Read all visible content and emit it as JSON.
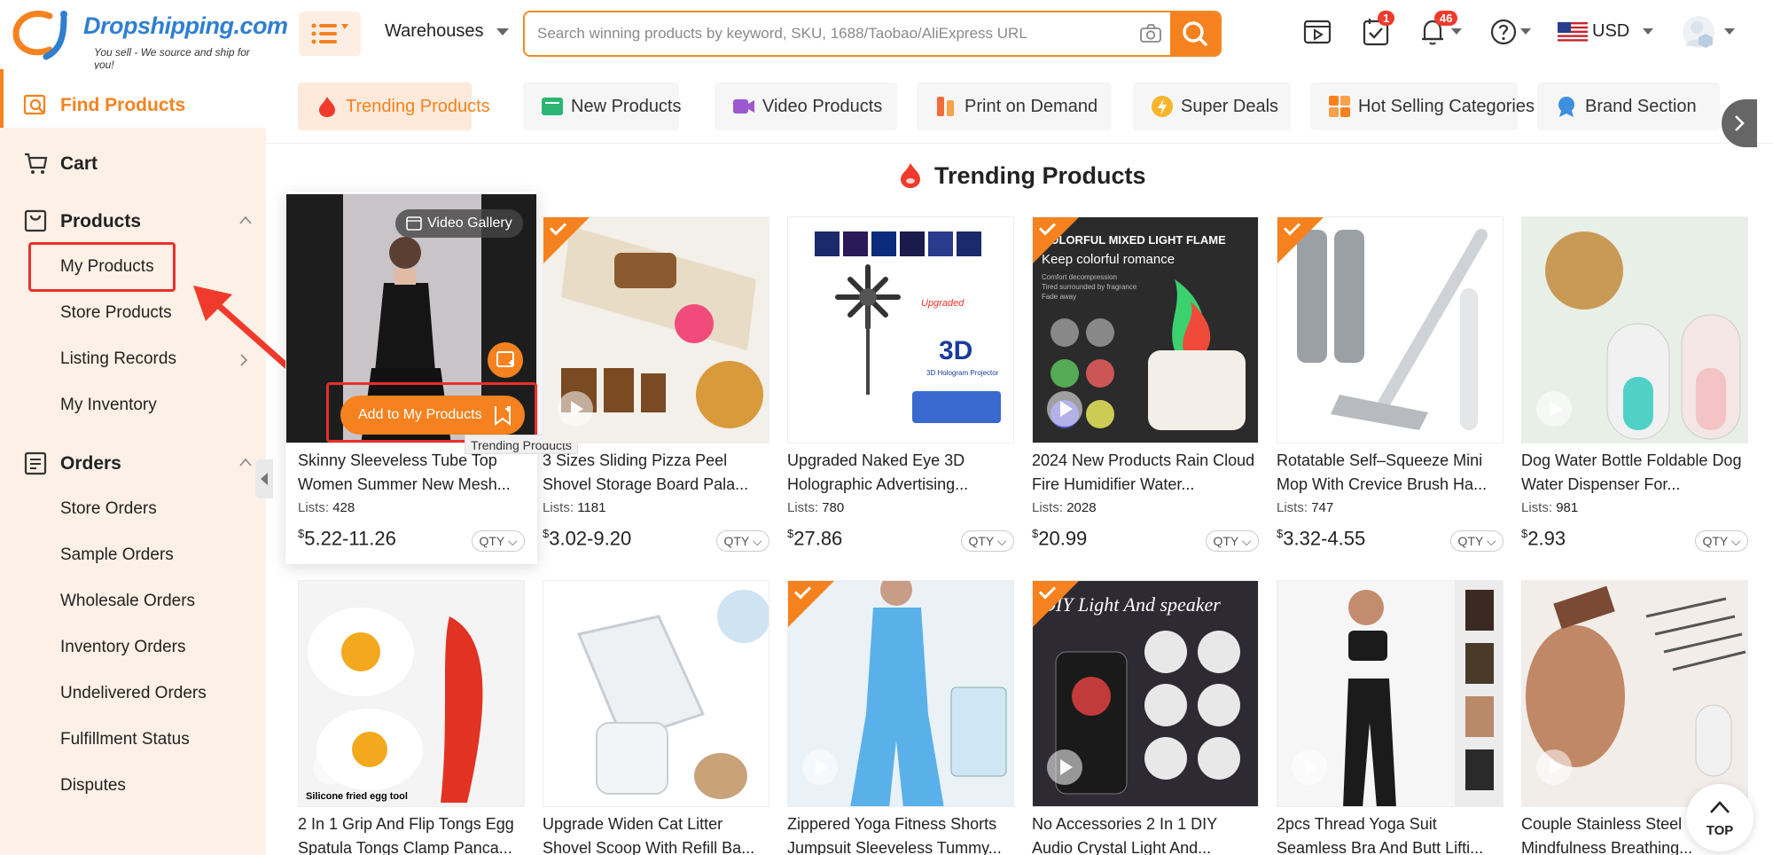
{
  "brand": {
    "name": "Dropshipping.com",
    "tagline": "You sell - We source and ship for you!"
  },
  "header": {
    "warehouses_label": "Warehouses",
    "search_placeholder": "Search winning products by keyword, SKU, 1688/Taobao/AliExpress URL",
    "task_badge": "1",
    "notification_badge": "46",
    "currency": "USD"
  },
  "sidebar": {
    "find_products": "Find Products",
    "cart": "Cart",
    "products": "Products",
    "products_sub": [
      "My Products",
      "Store Products",
      "Listing Records",
      "My Inventory"
    ],
    "orders": "Orders",
    "orders_sub": [
      "Store Orders",
      "Sample Orders",
      "Wholesale Orders",
      "Inventory Orders",
      "Undelivered Orders",
      "Fulfillment Status",
      "Disputes"
    ]
  },
  "tabs": [
    "Trending Products",
    "New Products",
    "Video Products",
    "Print on Demand",
    "Super Deals",
    "Hot Selling Categories",
    "Brand Section"
  ],
  "section_title": "Trending Products",
  "hover": {
    "video_gallery": "Video Gallery",
    "add_to_my_products": "Add to My Products",
    "tooltip": "Trending Products"
  },
  "products": [
    {
      "title": "Skinny Sleeveless Tube Top Women Summer New Mesh...",
      "lists_label": "Lists:",
      "lists": "428",
      "currency": "$",
      "price": "5.22-11.26",
      "qty": "QTY"
    },
    {
      "title": "3 Sizes Sliding Pizza Peel Shovel Storage Board Pala...",
      "lists_label": "Lists:",
      "lists": "1181",
      "currency": "$",
      "price": "3.02-9.20",
      "qty": "QTY"
    },
    {
      "title": "Upgraded Naked Eye 3D Holographic Advertising...",
      "lists_label": "Lists:",
      "lists": "780",
      "currency": "$",
      "price": "27.86",
      "qty": "QTY"
    },
    {
      "title": "2024 New Products Rain Cloud Fire Humidifier Water...",
      "lists_label": "Lists:",
      "lists": "2028",
      "currency": "$",
      "price": "20.99",
      "qty": "QTY"
    },
    {
      "title": "Rotatable Self–Squeeze Mini Mop With Crevice Brush Ha...",
      "lists_label": "Lists:",
      "lists": "747",
      "currency": "$",
      "price": "3.32-4.55",
      "qty": "QTY"
    },
    {
      "title": "Dog Water Bottle Foldable Dog Water Dispenser For...",
      "lists_label": "Lists:",
      "lists": "981",
      "currency": "$",
      "price": "2.93",
      "qty": "QTY"
    },
    {
      "title": "2 In 1 Grip And Flip Tongs Egg Spatula Tongs Clamp Panca..."
    },
    {
      "title": "Upgrade Widen Cat Litter Shovel Scoop With Refill Ba..."
    },
    {
      "title": "Zippered Yoga Fitness Shorts Jumpsuit Sleeveless Tummy..."
    },
    {
      "title": "No Accessories 2 In 1 DIY Audio Crystal Light And..."
    },
    {
      "title": "2pcs Thread Yoga Suit Seamless Bra And Butt Lifti..."
    },
    {
      "title": "Couple Stainless Steel Mindfulness Breathing..."
    }
  ],
  "image_text": {
    "p3_badge": "Upgraded",
    "p3_label": "3D",
    "p3_sub": "3D Hologram Projector",
    "p4_line1": "COLORFUL MIXED LIGHT FLAME",
    "p4_line2": "Keep colorful romance",
    "p4_line3": "Comfort decompression",
    "p4_line4": "Tired surrounded by fragrance",
    "p4_line5": "Fade away",
    "p7_caption": "Silicone fried egg tool",
    "p10_heading": "DIY Light And speaker"
  },
  "top_button": "TOP"
}
